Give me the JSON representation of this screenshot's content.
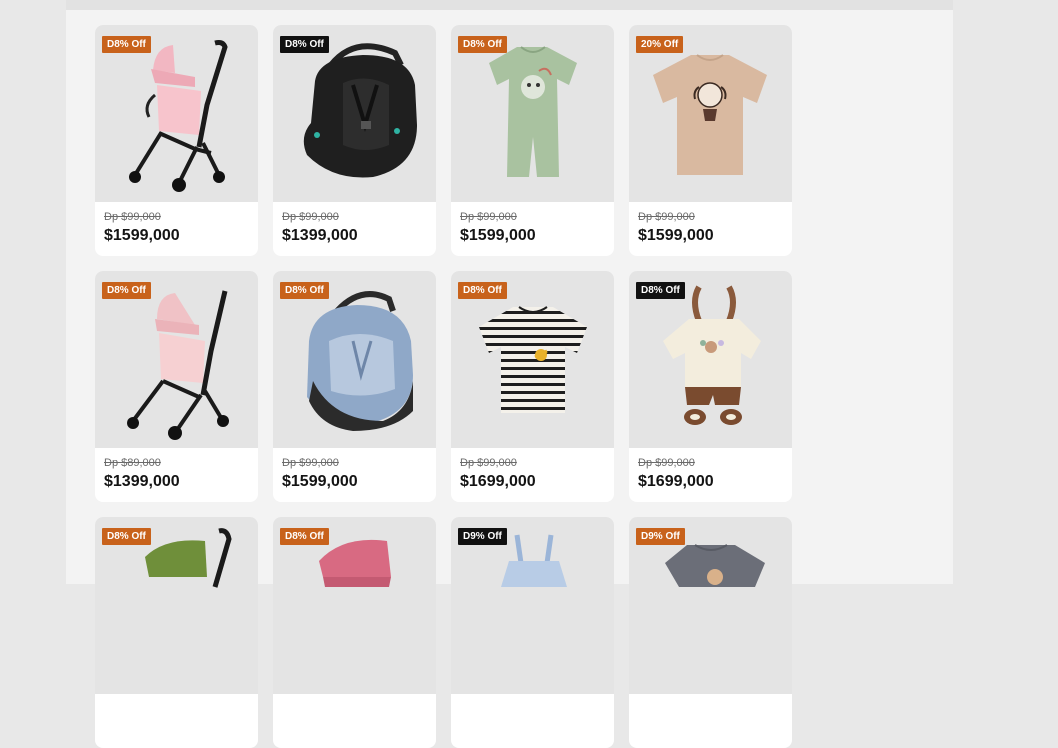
{
  "products": [
    {
      "badge": "D8% Off",
      "badge_color": "orange",
      "icon": "pink-stroller-icon",
      "old_price": "Dp $99,000",
      "price": "$1599,000"
    },
    {
      "badge": "D8% Off",
      "badge_color": "black",
      "icon": "black-car-seat-icon",
      "old_price": "Dp $99,000",
      "price": "$1399,000"
    },
    {
      "badge": "D8% Off",
      "badge_color": "orange",
      "icon": "green-romper-icon",
      "old_price": "Dp $99,000",
      "price": "$1599,000"
    },
    {
      "badge": "20% Off",
      "badge_color": "orange",
      "icon": "beige-tshirt-icon",
      "old_price": "Dp $99,000",
      "price": "$1599,000"
    },
    {
      "badge": "D8% Off",
      "badge_color": "orange",
      "icon": "pink-stroller-icon",
      "old_price": "Dp $89,000",
      "price": "$1399,000"
    },
    {
      "badge": "D8% Off",
      "badge_color": "orange",
      "icon": "blue-car-seat-icon",
      "old_price": "Dp $99,000",
      "price": "$1599,000"
    },
    {
      "badge": "D8% Off",
      "badge_color": "orange",
      "icon": "striped-tshirt-icon",
      "old_price": "Dp $99,000",
      "price": "$1699,000"
    },
    {
      "badge": "D8% Off",
      "badge_color": "black",
      "icon": "bunny-outfit-icon",
      "old_price": "Dp $99,000",
      "price": "$1699,000"
    },
    {
      "badge": "D8% Off",
      "badge_color": "orange",
      "icon": "green-stroller-icon",
      "old_price": "",
      "price": ""
    },
    {
      "badge": "D8% Off",
      "badge_color": "orange",
      "icon": "pink-stroller-icon",
      "old_price": "",
      "price": ""
    },
    {
      "badge": "D9% Off",
      "badge_color": "black",
      "icon": "blue-overalls-icon",
      "old_price": "",
      "price": ""
    },
    {
      "badge": "D9% Off",
      "badge_color": "orange",
      "icon": "gray-tshirt-icon",
      "old_price": "",
      "price": ""
    }
  ],
  "colors": {
    "badge_orange": "#c8621b",
    "badge_black": "#111111",
    "card_bg": "#ffffff",
    "image_bg": "#e4e4e4"
  }
}
